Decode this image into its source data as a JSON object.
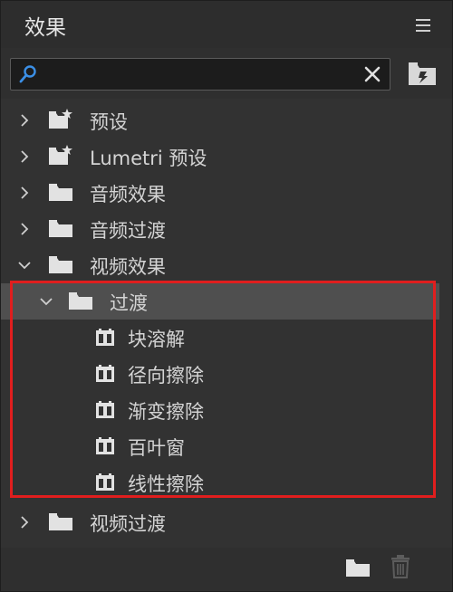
{
  "panel": {
    "title": "效果",
    "menu_icon": "hamburger-menu-icon"
  },
  "search": {
    "value": "",
    "placeholder": "",
    "icon": "search-icon",
    "clear_icon": "close-icon",
    "new_bin_icon": "new-custom-bin-icon"
  },
  "tree": {
    "items": [
      {
        "label": "预设",
        "level": 0,
        "expanded": false,
        "type": "preset-folder"
      },
      {
        "label": "Lumetri 预设",
        "level": 0,
        "expanded": false,
        "type": "preset-folder"
      },
      {
        "label": "音频效果",
        "level": 0,
        "expanded": false,
        "type": "folder"
      },
      {
        "label": "音频过渡",
        "level": 0,
        "expanded": false,
        "type": "folder"
      },
      {
        "label": "视频效果",
        "level": 0,
        "expanded": true,
        "type": "folder"
      },
      {
        "label": "过渡",
        "level": 1,
        "expanded": true,
        "type": "folder",
        "selected": true
      },
      {
        "label": "块溶解",
        "level": 2,
        "type": "effect"
      },
      {
        "label": "径向擦除",
        "level": 2,
        "type": "effect"
      },
      {
        "label": "渐变擦除",
        "level": 2,
        "type": "effect"
      },
      {
        "label": "百叶窗",
        "level": 2,
        "type": "effect"
      },
      {
        "label": "线性擦除",
        "level": 2,
        "type": "effect"
      },
      {
        "label": "视频过渡",
        "level": 0,
        "expanded": false,
        "type": "folder"
      }
    ]
  },
  "footer": {
    "new_bin_icon": "new-folder-icon",
    "trash_icon": "trash-icon"
  },
  "colors": {
    "panel_bg": "#323232",
    "selected_row": "#4f4f4f",
    "highlight_border": "#e01e1e",
    "search_icon": "#3b8fe6"
  }
}
